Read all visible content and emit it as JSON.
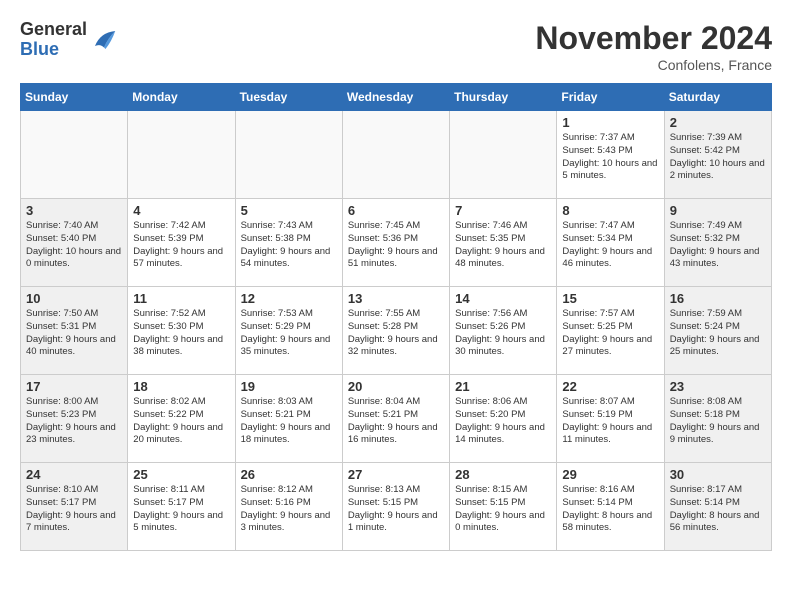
{
  "header": {
    "logo_general": "General",
    "logo_blue": "Blue",
    "month_title": "November 2024",
    "location": "Confolens, France"
  },
  "weekdays": [
    "Sunday",
    "Monday",
    "Tuesday",
    "Wednesday",
    "Thursday",
    "Friday",
    "Saturday"
  ],
  "weeks": [
    [
      {
        "day": "",
        "empty": true
      },
      {
        "day": "",
        "empty": true
      },
      {
        "day": "",
        "empty": true
      },
      {
        "day": "",
        "empty": true
      },
      {
        "day": "",
        "empty": true
      },
      {
        "day": "1",
        "sunrise": "Sunrise: 7:37 AM",
        "sunset": "Sunset: 5:43 PM",
        "daylight": "Daylight: 10 hours and 5 minutes."
      },
      {
        "day": "2",
        "sunrise": "Sunrise: 7:39 AM",
        "sunset": "Sunset: 5:42 PM",
        "daylight": "Daylight: 10 hours and 2 minutes.",
        "weekend": true
      }
    ],
    [
      {
        "day": "3",
        "sunrise": "Sunrise: 7:40 AM",
        "sunset": "Sunset: 5:40 PM",
        "daylight": "Daylight: 10 hours and 0 minutes.",
        "weekend": true
      },
      {
        "day": "4",
        "sunrise": "Sunrise: 7:42 AM",
        "sunset": "Sunset: 5:39 PM",
        "daylight": "Daylight: 9 hours and 57 minutes."
      },
      {
        "day": "5",
        "sunrise": "Sunrise: 7:43 AM",
        "sunset": "Sunset: 5:38 PM",
        "daylight": "Daylight: 9 hours and 54 minutes."
      },
      {
        "day": "6",
        "sunrise": "Sunrise: 7:45 AM",
        "sunset": "Sunset: 5:36 PM",
        "daylight": "Daylight: 9 hours and 51 minutes."
      },
      {
        "day": "7",
        "sunrise": "Sunrise: 7:46 AM",
        "sunset": "Sunset: 5:35 PM",
        "daylight": "Daylight: 9 hours and 48 minutes."
      },
      {
        "day": "8",
        "sunrise": "Sunrise: 7:47 AM",
        "sunset": "Sunset: 5:34 PM",
        "daylight": "Daylight: 9 hours and 46 minutes."
      },
      {
        "day": "9",
        "sunrise": "Sunrise: 7:49 AM",
        "sunset": "Sunset: 5:32 PM",
        "daylight": "Daylight: 9 hours and 43 minutes.",
        "weekend": true
      }
    ],
    [
      {
        "day": "10",
        "sunrise": "Sunrise: 7:50 AM",
        "sunset": "Sunset: 5:31 PM",
        "daylight": "Daylight: 9 hours and 40 minutes.",
        "weekend": true
      },
      {
        "day": "11",
        "sunrise": "Sunrise: 7:52 AM",
        "sunset": "Sunset: 5:30 PM",
        "daylight": "Daylight: 9 hours and 38 minutes."
      },
      {
        "day": "12",
        "sunrise": "Sunrise: 7:53 AM",
        "sunset": "Sunset: 5:29 PM",
        "daylight": "Daylight: 9 hours and 35 minutes."
      },
      {
        "day": "13",
        "sunrise": "Sunrise: 7:55 AM",
        "sunset": "Sunset: 5:28 PM",
        "daylight": "Daylight: 9 hours and 32 minutes."
      },
      {
        "day": "14",
        "sunrise": "Sunrise: 7:56 AM",
        "sunset": "Sunset: 5:26 PM",
        "daylight": "Daylight: 9 hours and 30 minutes."
      },
      {
        "day": "15",
        "sunrise": "Sunrise: 7:57 AM",
        "sunset": "Sunset: 5:25 PM",
        "daylight": "Daylight: 9 hours and 27 minutes."
      },
      {
        "day": "16",
        "sunrise": "Sunrise: 7:59 AM",
        "sunset": "Sunset: 5:24 PM",
        "daylight": "Daylight: 9 hours and 25 minutes.",
        "weekend": true
      }
    ],
    [
      {
        "day": "17",
        "sunrise": "Sunrise: 8:00 AM",
        "sunset": "Sunset: 5:23 PM",
        "daylight": "Daylight: 9 hours and 23 minutes.",
        "weekend": true
      },
      {
        "day": "18",
        "sunrise": "Sunrise: 8:02 AM",
        "sunset": "Sunset: 5:22 PM",
        "daylight": "Daylight: 9 hours and 20 minutes."
      },
      {
        "day": "19",
        "sunrise": "Sunrise: 8:03 AM",
        "sunset": "Sunset: 5:21 PM",
        "daylight": "Daylight: 9 hours and 18 minutes."
      },
      {
        "day": "20",
        "sunrise": "Sunrise: 8:04 AM",
        "sunset": "Sunset: 5:21 PM",
        "daylight": "Daylight: 9 hours and 16 minutes."
      },
      {
        "day": "21",
        "sunrise": "Sunrise: 8:06 AM",
        "sunset": "Sunset: 5:20 PM",
        "daylight": "Daylight: 9 hours and 14 minutes."
      },
      {
        "day": "22",
        "sunrise": "Sunrise: 8:07 AM",
        "sunset": "Sunset: 5:19 PM",
        "daylight": "Daylight: 9 hours and 11 minutes."
      },
      {
        "day": "23",
        "sunrise": "Sunrise: 8:08 AM",
        "sunset": "Sunset: 5:18 PM",
        "daylight": "Daylight: 9 hours and 9 minutes.",
        "weekend": true
      }
    ],
    [
      {
        "day": "24",
        "sunrise": "Sunrise: 8:10 AM",
        "sunset": "Sunset: 5:17 PM",
        "daylight": "Daylight: 9 hours and 7 minutes.",
        "weekend": true
      },
      {
        "day": "25",
        "sunrise": "Sunrise: 8:11 AM",
        "sunset": "Sunset: 5:17 PM",
        "daylight": "Daylight: 9 hours and 5 minutes."
      },
      {
        "day": "26",
        "sunrise": "Sunrise: 8:12 AM",
        "sunset": "Sunset: 5:16 PM",
        "daylight": "Daylight: 9 hours and 3 minutes."
      },
      {
        "day": "27",
        "sunrise": "Sunrise: 8:13 AM",
        "sunset": "Sunset: 5:15 PM",
        "daylight": "Daylight: 9 hours and 1 minute."
      },
      {
        "day": "28",
        "sunrise": "Sunrise: 8:15 AM",
        "sunset": "Sunset: 5:15 PM",
        "daylight": "Daylight: 9 hours and 0 minutes."
      },
      {
        "day": "29",
        "sunrise": "Sunrise: 8:16 AM",
        "sunset": "Sunset: 5:14 PM",
        "daylight": "Daylight: 8 hours and 58 minutes."
      },
      {
        "day": "30",
        "sunrise": "Sunrise: 8:17 AM",
        "sunset": "Sunset: 5:14 PM",
        "daylight": "Daylight: 8 hours and 56 minutes.",
        "weekend": true
      }
    ]
  ]
}
